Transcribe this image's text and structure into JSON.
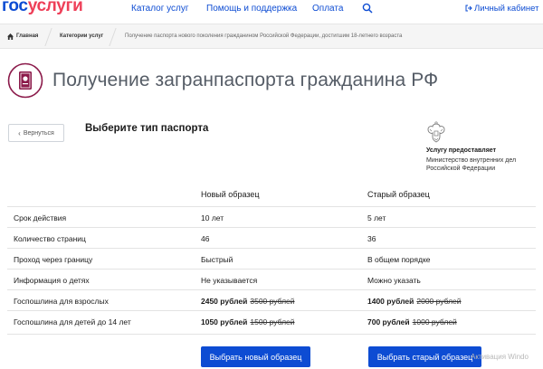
{
  "header": {
    "logo_part1": "гос",
    "logo_part2": "услуги",
    "nav": [
      "Каталог услуг",
      "Помощь и поддержка",
      "Оплата"
    ],
    "login": "Личный кабинет"
  },
  "breadcrumbs": {
    "home": "Главная",
    "catalog": "Категории услуг",
    "current": "Получение паспорта нового поколения гражданином Российской Федерации, достигшим 18-летнего возраста"
  },
  "page": {
    "title": "Получение загранпаспорта гражданина РФ",
    "back_label": "Вернуться",
    "choose_title": "Выберите тип паспорта"
  },
  "provider": {
    "label": "Услугу предоставляет",
    "name": "Министерство внутренних дел Российской Федерации"
  },
  "table": {
    "columns": [
      "Новый образец",
      "Старый образец"
    ],
    "rows": [
      {
        "label": "Срок действия",
        "new": "10 лет",
        "old": "5 лет"
      },
      {
        "label": "Количество страниц",
        "new": "46",
        "old": "36"
      },
      {
        "label": "Проход через границу",
        "new": "Быстрый",
        "old": "В общем порядке"
      },
      {
        "label": "Информация о детях",
        "new": "Не указывается",
        "old": "Можно указать"
      },
      {
        "label": "Госпошлина для взрослых",
        "new_price": "2450 рублей",
        "new_old_price": "3500 рублей",
        "old_price": "1400 рублей",
        "old_old_price": "2000 рублей"
      },
      {
        "label": "Госпошлина для детей до 14 лет",
        "new_price": "1050 рублей",
        "new_old_price": "1500 рублей",
        "old_price": "700 рублей",
        "old_old_price": "1000 рублей"
      }
    ]
  },
  "buttons": {
    "choose_new": "Выбрать новый образец",
    "choose_old": "Выбрать старый образец"
  },
  "watermark": "Активация Windo",
  "colors": {
    "brand_blue": "#0d4cd3",
    "brand_red": "#ee3f58",
    "icon_maroon": "#8b1a4a"
  }
}
